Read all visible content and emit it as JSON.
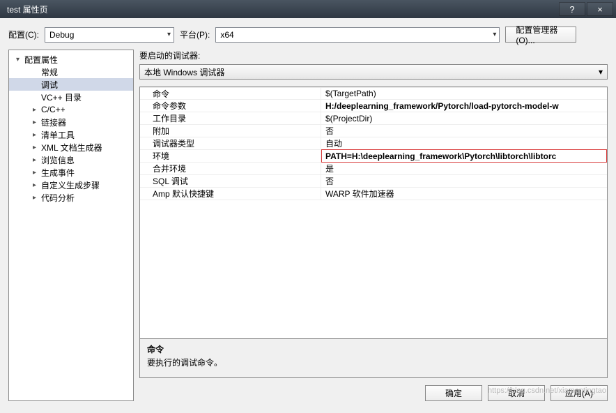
{
  "titlebar": {
    "title": "test 属性页",
    "help": "?",
    "close": "×"
  },
  "top": {
    "config_label": "配置(C):",
    "config_value": "Debug",
    "platform_label": "平台(P):",
    "platform_value": "x64",
    "config_manager": "配置管理器(O)..."
  },
  "tree": {
    "items": [
      {
        "label": "配置属性",
        "level": 1,
        "expander": "▾"
      },
      {
        "label": "常规",
        "level": 2,
        "expander": ""
      },
      {
        "label": "调试",
        "level": 2,
        "expander": "",
        "selected": true
      },
      {
        "label": "VC++ 目录",
        "level": 2,
        "expander": ""
      },
      {
        "label": "C/C++",
        "level": 2,
        "expander": "▸"
      },
      {
        "label": "链接器",
        "level": 2,
        "expander": "▸"
      },
      {
        "label": "清单工具",
        "level": 2,
        "expander": "▸"
      },
      {
        "label": "XML 文档生成器",
        "level": 2,
        "expander": "▸"
      },
      {
        "label": "浏览信息",
        "level": 2,
        "expander": "▸"
      },
      {
        "label": "生成事件",
        "level": 2,
        "expander": "▸"
      },
      {
        "label": "自定义生成步骤",
        "level": 2,
        "expander": "▸"
      },
      {
        "label": "代码分析",
        "level": 2,
        "expander": "▸"
      }
    ]
  },
  "debugger": {
    "launch_label": "要启动的调试器:",
    "launch_value": "本地 Windows 调试器"
  },
  "grid": {
    "rows": [
      {
        "label": "命令",
        "value": "$(TargetPath)"
      },
      {
        "label": "命令参数",
        "value": "H:/deeplearning_framework/Pytorch/load-pytorch-model-w",
        "bold": true
      },
      {
        "label": "工作目录",
        "value": "$(ProjectDir)"
      },
      {
        "label": "附加",
        "value": "否"
      },
      {
        "label": "调试器类型",
        "value": "自动"
      },
      {
        "label": "环境",
        "value": "PATH=H:\\deeplearning_framework\\Pytorch\\libtorch\\libtorc",
        "highlight": true
      },
      {
        "label": "合并环境",
        "value": "是"
      },
      {
        "label": "SQL 调试",
        "value": "否"
      },
      {
        "label": "Amp 默认快捷键",
        "value": "WARP 软件加速器"
      }
    ]
  },
  "desc": {
    "title": "命令",
    "text": "要执行的调试命令。"
  },
  "footer": {
    "ok": "确定",
    "cancel": "取消",
    "apply": "应用(A)"
  },
  "watermark": "https://blog.csdn.net/xiamentingtao"
}
